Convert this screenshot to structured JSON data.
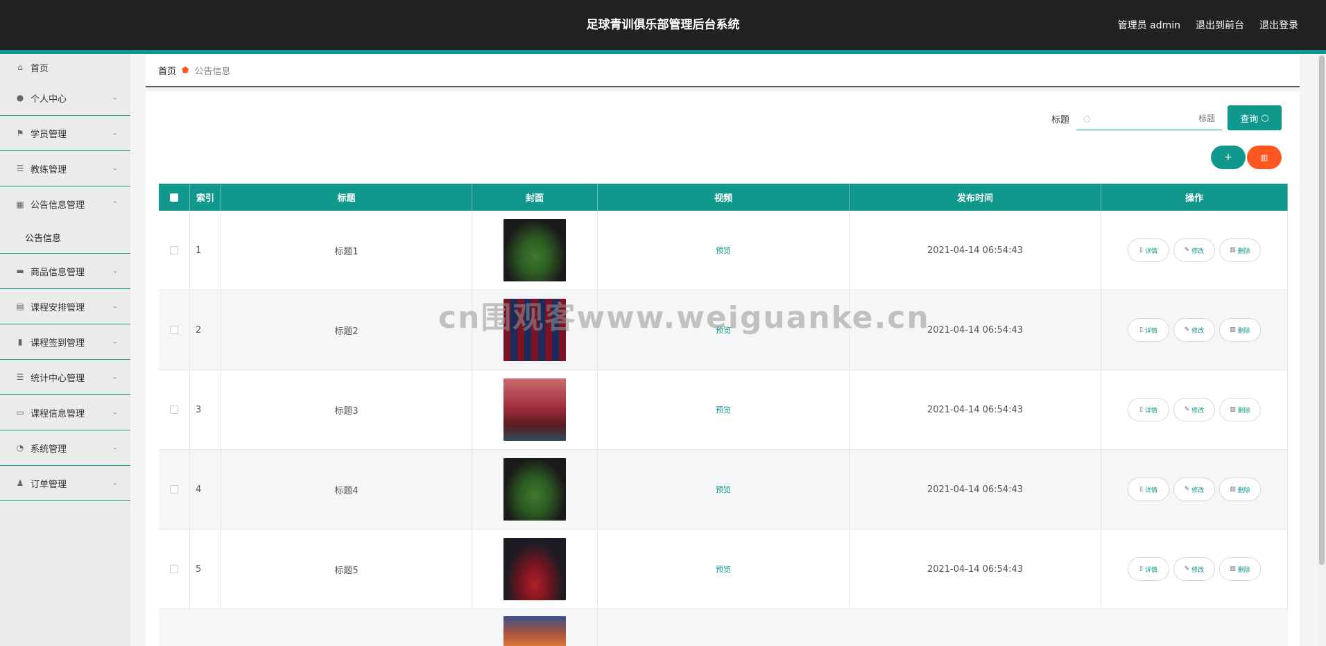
{
  "header": {
    "title": "足球青训俱乐部管理后台系统",
    "user_label": "管理员 admin",
    "to_front": "退出到前台",
    "logout": "退出登录"
  },
  "sidebar": {
    "items": [
      {
        "label": "首页",
        "icon": "home-icon"
      },
      {
        "label": "个人中心",
        "icon": "user-icon"
      },
      {
        "label": "学员管理",
        "icon": "flag-icon"
      },
      {
        "label": "教练管理",
        "icon": "list-icon"
      },
      {
        "label": "公告信息管理",
        "icon": "grid-icon"
      },
      {
        "label": "商品信息管理",
        "icon": "chat-icon"
      },
      {
        "label": "课程安排管理",
        "icon": "clipboard-icon"
      },
      {
        "label": "课程签到管理",
        "icon": "bar-chart-icon"
      },
      {
        "label": "统计中心管理",
        "icon": "list-icon"
      },
      {
        "label": "课程信息管理",
        "icon": "monitor-icon"
      },
      {
        "label": "系统管理",
        "icon": "gauge-icon"
      },
      {
        "label": "订单管理",
        "icon": "person-icon"
      }
    ],
    "sub_item": "公告信息"
  },
  "breadcrumb": {
    "home": "首页",
    "current": "公告信息"
  },
  "search": {
    "label": "标题",
    "placeholder": "标题",
    "button": "查询"
  },
  "actions": {
    "add": "+",
    "delete_icon": "trash-icon"
  },
  "table": {
    "headers": [
      "索引",
      "标题",
      "封面",
      "视频",
      "发布时间",
      "操作"
    ],
    "rows": [
      {
        "index": "1",
        "title": "标题1",
        "video": "预览",
        "time": "2021-04-14 06:54:43"
      },
      {
        "index": "2",
        "title": "标题2",
        "video": "预览",
        "time": "2021-04-14 06:54:43"
      },
      {
        "index": "3",
        "title": "标题3",
        "video": "预览",
        "time": "2021-04-14 06:54:43"
      },
      {
        "index": "4",
        "title": "标题4",
        "video": "预览",
        "time": "2021-04-14 06:54:43"
      },
      {
        "index": "5",
        "title": "标题5",
        "video": "预览",
        "time": "2021-04-14 06:54:43"
      }
    ],
    "ops": {
      "detail": "详情",
      "edit": "修改",
      "delete": "删除"
    }
  },
  "watermark": "cn围观客www.weiguanke.cn",
  "colors": {
    "accent": "#11988c",
    "danger": "#ff5722",
    "header": "#222222"
  }
}
